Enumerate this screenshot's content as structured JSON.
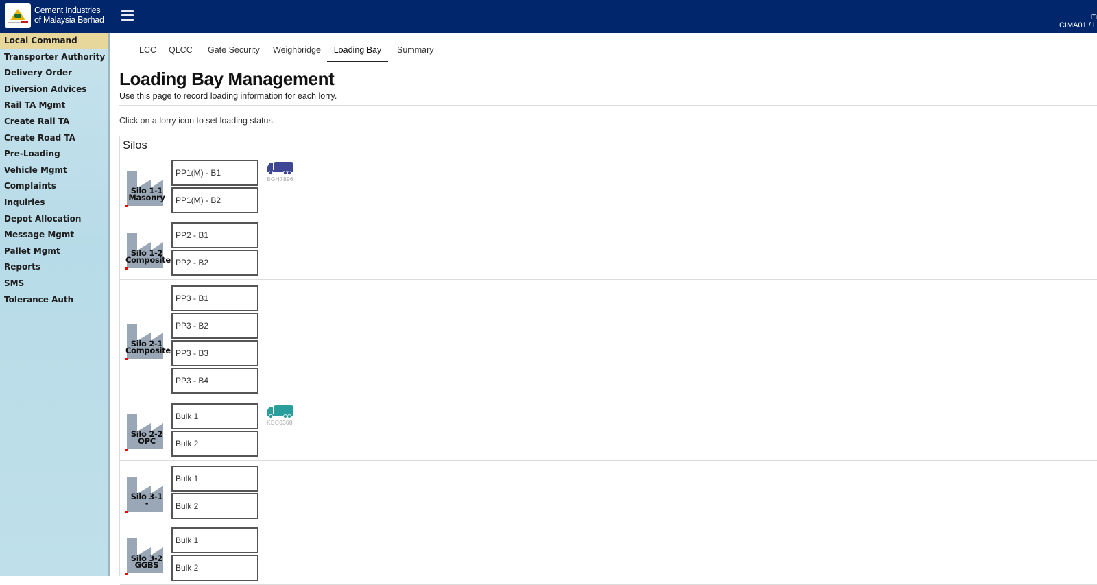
{
  "header": {
    "company_line1": "Cement Industries",
    "company_line2": "of Malaysia Berhad",
    "user_line1": "m",
    "user_line2": "CIMA01 / L"
  },
  "sidebar": {
    "items": [
      {
        "label": "Local Command",
        "active": true
      },
      {
        "label": "Transporter Authority"
      },
      {
        "label": "Delivery Order"
      },
      {
        "label": "Diversion Advices"
      },
      {
        "label": "Rail TA Mgmt"
      },
      {
        "label": "Create Rail TA"
      },
      {
        "label": "Create Road TA"
      },
      {
        "label": "Pre-Loading"
      },
      {
        "label": "Vehicle Mgmt"
      },
      {
        "label": "Complaints"
      },
      {
        "label": "Inquiries"
      },
      {
        "label": "Depot Allocation"
      },
      {
        "label": "Message Mgmt"
      },
      {
        "label": "Pallet Mgmt"
      },
      {
        "label": "Reports"
      },
      {
        "label": "SMS"
      },
      {
        "label": "Tolerance Auth"
      }
    ]
  },
  "tabs": [
    {
      "label": "LCC"
    },
    {
      "label": "QLCC"
    },
    {
      "label": "Gate Security"
    },
    {
      "label": "Weighbridge"
    },
    {
      "label": "Loading Bay",
      "active": true
    },
    {
      "label": "Summary"
    }
  ],
  "page": {
    "title": "Loading Bay Management",
    "subtitle": "Use this page to record loading information for each lorry.",
    "instruction": "Click on a lorry icon to set loading status.",
    "section_title": "Silos"
  },
  "silos": [
    {
      "name": "Silo 1-1",
      "type": "Masonry",
      "bays": [
        "PP1(M) - B1",
        "PP1(M) - B2"
      ],
      "lorry": {
        "plate": "BGH7896",
        "color": "#3f4794"
      }
    },
    {
      "name": "Silo 1-2",
      "type": "Composite",
      "bays": [
        "PP2 - B1",
        "PP2 - B2"
      ]
    },
    {
      "name": "Silo 2-1",
      "type": "Composite",
      "bays": [
        "PP3 - B1",
        "PP3 - B2",
        "PP3 - B3",
        "PP3 - B4"
      ]
    },
    {
      "name": "Silo 2-2",
      "type": "OPC",
      "bays": [
        "Bulk 1",
        "Bulk 2"
      ],
      "lorry": {
        "plate": "KEC6368",
        "color": "#2a9e9c"
      }
    },
    {
      "name": "Silo 3-1",
      "type": "-",
      "bays": [
        "Bulk 1",
        "Bulk 2"
      ]
    },
    {
      "name": "Silo 3-2",
      "type": "GGBS",
      "bays": [
        "Bulk 1",
        "Bulk 2"
      ]
    }
  ],
  "colors": {
    "header_bg": "#02266b",
    "sidebar_active": "#e7d79a",
    "silo_icon": "#9aa7b6"
  },
  "icons": {
    "menu": "hamburger-menu-icon",
    "silo": "factory-silo-icon",
    "lorry": "lorry-truck-icon"
  }
}
